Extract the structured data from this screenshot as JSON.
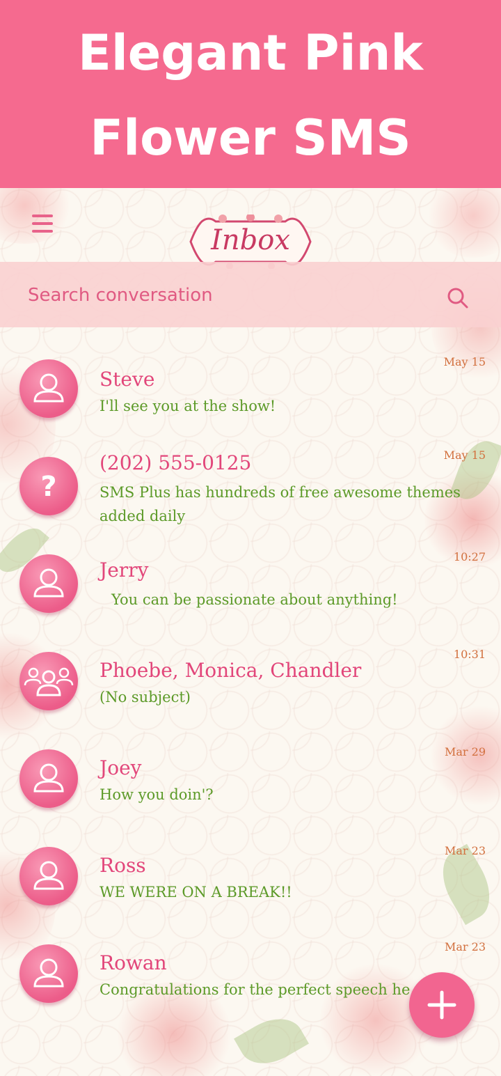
{
  "banner": {
    "line1": "Elegant Pink",
    "line2": "Flower SMS"
  },
  "header": {
    "title": "Inbox"
  },
  "search": {
    "placeholder": "Search conversation"
  },
  "conversations": [
    {
      "name": "Steve",
      "message": "I'll see you at the show!",
      "time": "May 15",
      "avatar": "person-icon"
    },
    {
      "name": "(202) 555-0125",
      "message": "SMS Plus has hundreds of free awesome themes added daily",
      "time": "May 15",
      "avatar": "unknown-contact-icon"
    },
    {
      "name": "Jerry",
      "message": "You can be passionate about anything!",
      "time": "10:27",
      "avatar": "person-icon"
    },
    {
      "name": "Phoebe, Monica, Chandler",
      "message": "(No subject)",
      "time": "10:31",
      "avatar": "group-icon"
    },
    {
      "name": "Joey",
      "message": "How you doin'?",
      "time": "Mar 29",
      "avatar": "person-icon"
    },
    {
      "name": "Ross",
      "message": "WE WERE ON A BREAK!!",
      "time": "Mar 23",
      "avatar": "person-icon"
    },
    {
      "name": "Rowan",
      "message": "Congratulations for the perfect speech he",
      "time": "Mar 23",
      "avatar": "person-icon"
    }
  ],
  "colors": {
    "banner": "#f56a8f",
    "accent": "#e2467a",
    "message": "#5c9a28",
    "time": "#d2703e"
  }
}
